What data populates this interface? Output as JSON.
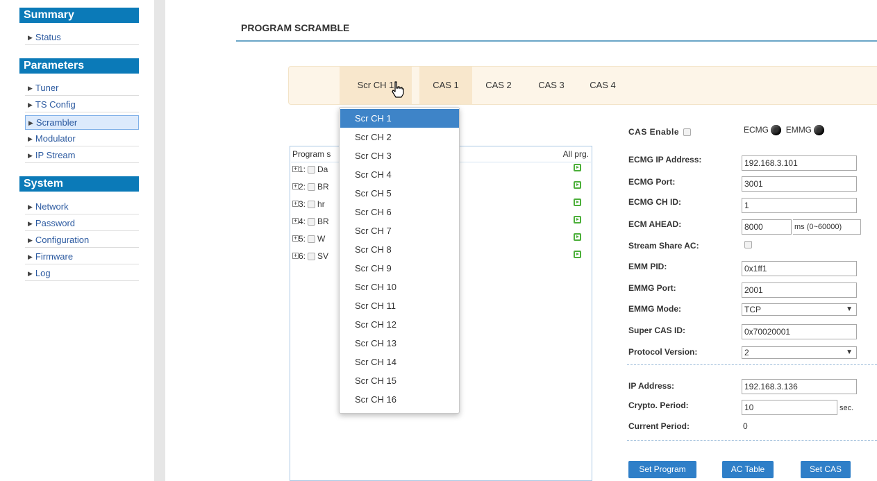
{
  "sidebar": {
    "summary_header": "Summary",
    "summary_items": [
      "Status"
    ],
    "parameters_header": "Parameters",
    "parameters_items": [
      "Tuner",
      "TS Config",
      "Scrambler",
      "Modulator",
      "IP Stream"
    ],
    "system_header": "System",
    "system_items": [
      "Network",
      "Password",
      "Configuration",
      "Firmware",
      "Log"
    ],
    "active_item": "Scrambler"
  },
  "page": {
    "title": "PROGRAM SCRAMBLE"
  },
  "tabs": {
    "scr_ch_label": "Scr CH 1",
    "cas": [
      "CAS 1",
      "CAS 2",
      "CAS 3",
      "CAS 4"
    ]
  },
  "dropdown": {
    "options": [
      "Scr CH 1",
      "Scr CH 2",
      "Scr CH 3",
      "Scr CH 4",
      "Scr CH 5",
      "Scr CH 6",
      "Scr CH 7",
      "Scr CH 8",
      "Scr CH 9",
      "Scr CH 10",
      "Scr CH 11",
      "Scr CH 12",
      "Scr CH 13",
      "Scr CH 14",
      "Scr CH 15",
      "Scr CH 16"
    ],
    "selected": "Scr CH 1"
  },
  "program_list": {
    "header_left": "Program s",
    "header_right": "All prg.",
    "rows": [
      {
        "num": "1:",
        "name": "Da"
      },
      {
        "num": "2:",
        "name": "BR"
      },
      {
        "num": "3:",
        "name": "hr"
      },
      {
        "num": "4:",
        "name": "BR"
      },
      {
        "num": "5:",
        "name": "W"
      },
      {
        "num": "6:",
        "name": "SV"
      }
    ]
  },
  "cas_form": {
    "cas_enable_label": "CAS Enable",
    "ecmg_label": "ECMG",
    "emmg_label": "EMMG",
    "ecmg_ip_label": "ECMG IP Address:",
    "ecmg_ip": "192.168.3.101",
    "ecmg_port_label": "ECMG Port:",
    "ecmg_port": "3001",
    "ecmg_ch_id_label": "ECMG CH ID:",
    "ecmg_ch_id": "1",
    "ecm_ahead_label": "ECM AHEAD:",
    "ecm_ahead": "8000",
    "ecm_ahead_unit": "ms (0~60000)",
    "stream_share_label": "Stream Share AC:",
    "emm_pid_label": "EMM PID:",
    "emm_pid": "0x1ff1",
    "emmg_port_label": "EMMG Port:",
    "emmg_port": "2001",
    "emmg_mode_label": "EMMG Mode:",
    "emmg_mode": "TCP",
    "super_cas_label": "Super CAS ID:",
    "super_cas": "0x70020001",
    "protocol_label": "Protocol Version:",
    "protocol": "2",
    "ip_label": "IP Address:",
    "ip": "192.168.3.136",
    "crypto_label": "Crypto. Period:",
    "crypto": "10",
    "crypto_unit": "sec.",
    "current_label": "Current Period:",
    "current": "0"
  },
  "buttons": {
    "set_program": "Set Program",
    "ac_table": "AC Table",
    "set_cas": "Set CAS"
  },
  "colors": {
    "sidebar_header": "#0b7ab8",
    "button": "#2f7fc8",
    "dropdown_selected": "#3e84c8",
    "tab_bar": "#fdf5e8"
  }
}
